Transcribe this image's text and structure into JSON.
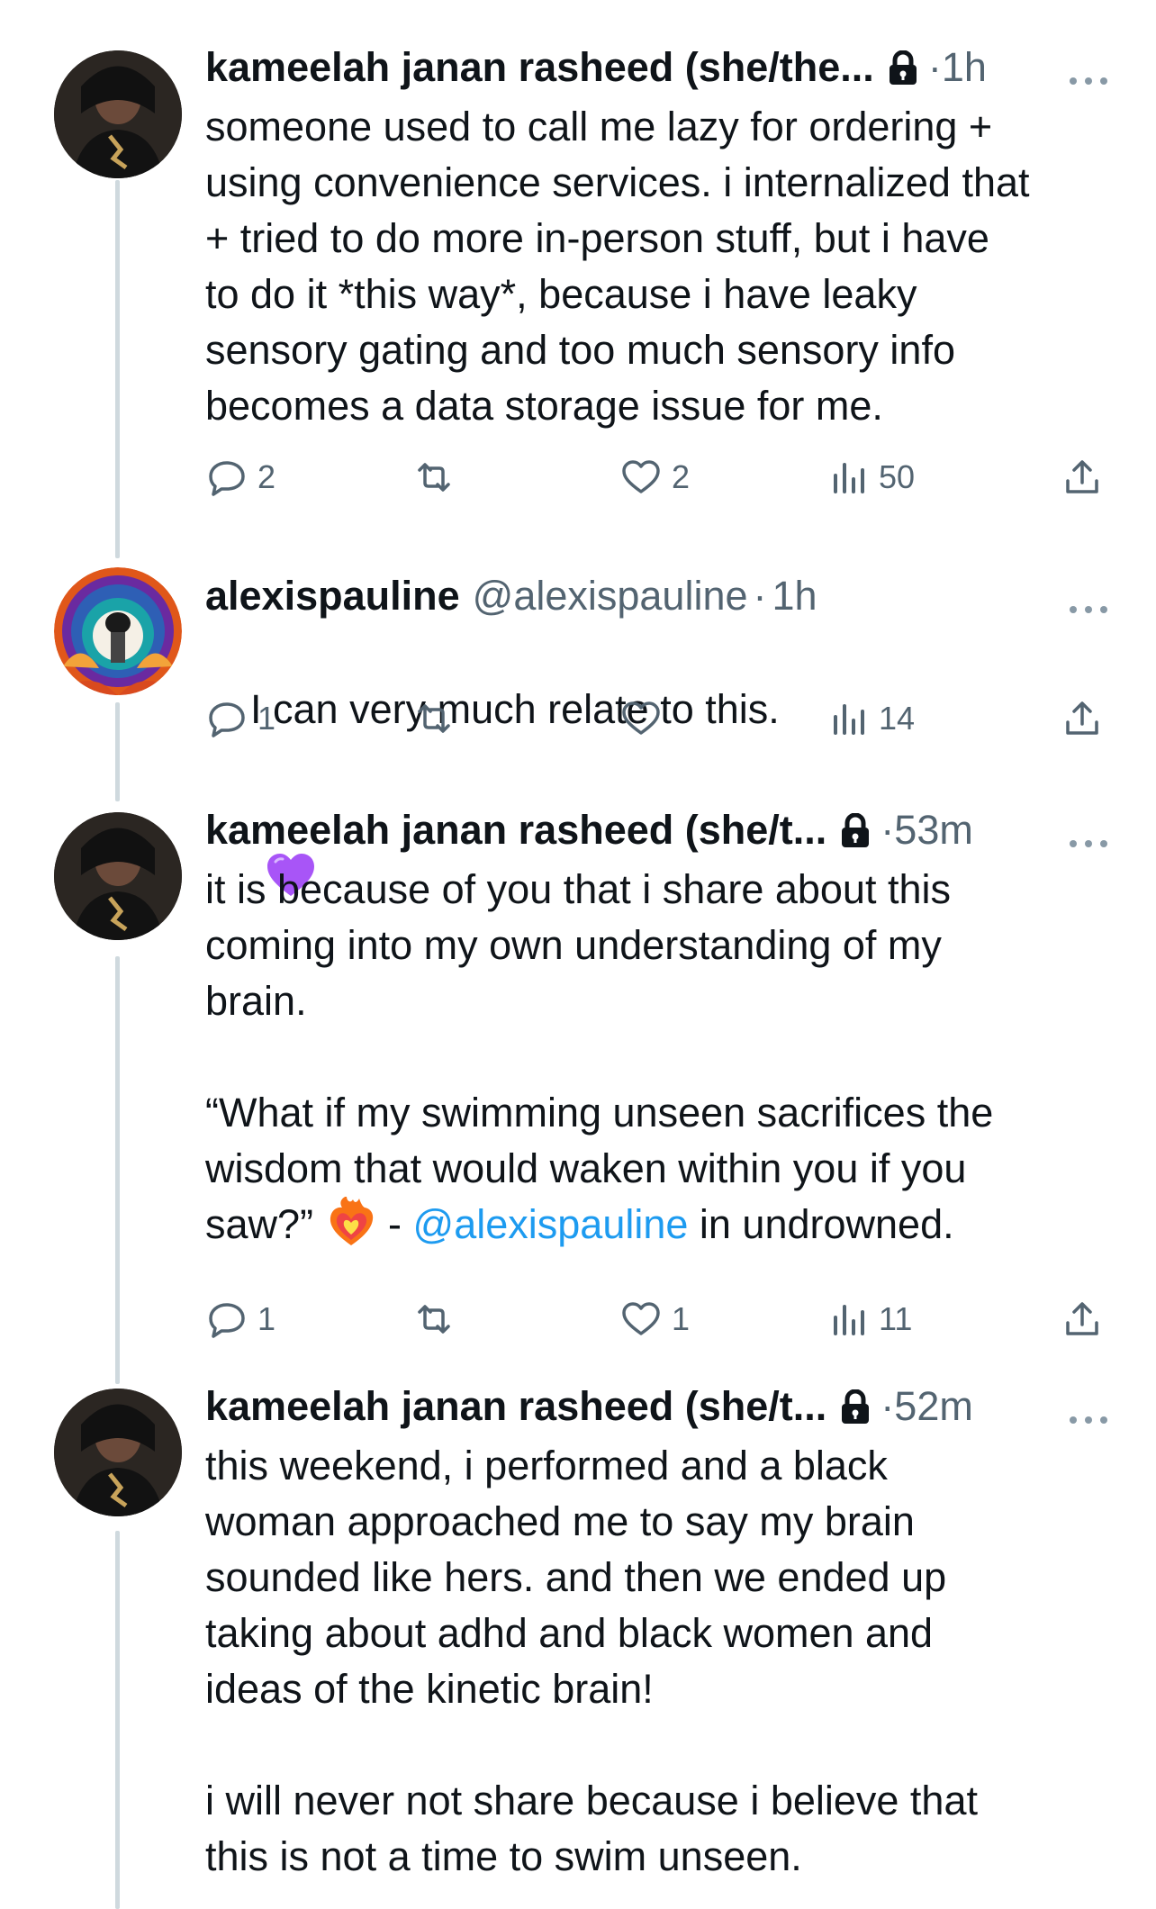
{
  "tweets": [
    {
      "author": "kameelah janan rasheed (she/the...",
      "handle": "",
      "time": "1h",
      "protected": true,
      "text": "someone used to call me lazy for ordering +\nusing convenience services. i internalized that\n+ tried to do more in-person stuff, but i have\nto do it *this way*, because i have leaky\nsensory gating and too much sensory info\nbecomes a data storage issue for me.",
      "replies": "2",
      "reposts": "",
      "likes": "2",
      "views": "50"
    },
    {
      "author": "alexispauline",
      "handle": "@alexispauline",
      "time": "1h",
      "protected": false,
      "text": "I can very much relate to this.",
      "emoji": "purple-heart",
      "replies": "1",
      "reposts": "",
      "likes": "",
      "views": "14"
    },
    {
      "author": "kameelah janan rasheed (she/t...",
      "handle": "",
      "time": "53m",
      "protected": true,
      "text_a": "it is because of you that i share about this\ncoming into my own understanding of my\nbrain.\n\n“What if my swimming unseen sacrifices the\nwisdom that would waken within you if you\nsaw?” ",
      "emoji": "heart-on-fire",
      "text_b": " - ",
      "mention": "@alexispauline",
      "text_c": " in undrowned.",
      "replies": "1",
      "reposts": "",
      "likes": "1",
      "views": "11"
    },
    {
      "author": "kameelah janan rasheed (she/t...",
      "handle": "",
      "time": "52m",
      "protected": true,
      "text": "this weekend, i performed and a black\nwoman approached me to say my brain\nsounded like hers. and then we ended up\ntaking about adhd and black women and\nideas of the kinetic brain!\n\ni will never not share because i believe that\nthis is not a time to swim unseen."
    }
  ],
  "colors": {
    "text": "#0f1419",
    "meta": "#536471",
    "link": "#1d9bf0",
    "thread_line": "#cfd9de"
  }
}
